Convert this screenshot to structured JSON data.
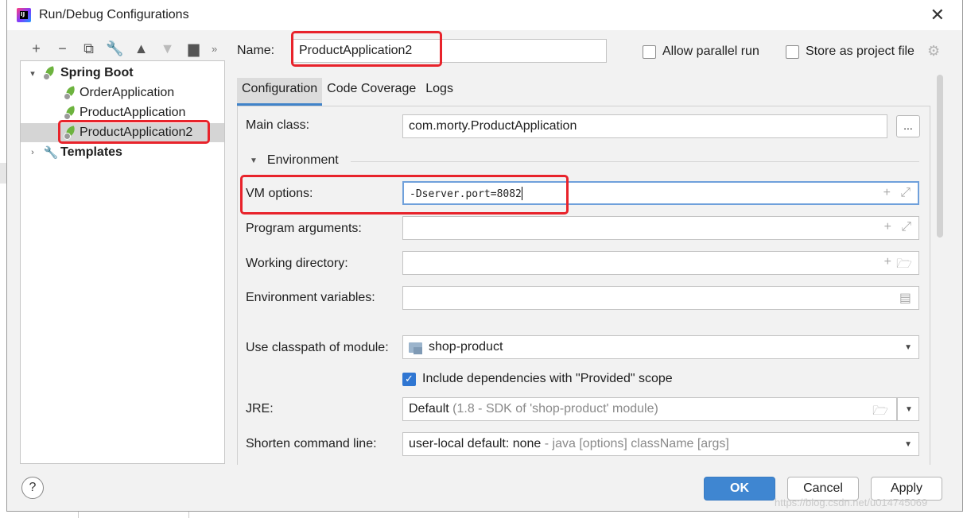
{
  "window": {
    "title": "Run/Debug Configurations",
    "app_icon_text": "IJ"
  },
  "toolbar": {
    "more": "»"
  },
  "tree": {
    "groups": [
      {
        "label": "Spring Boot",
        "expanded": true,
        "items": [
          {
            "label": "OrderApplication"
          },
          {
            "label": "ProductApplication"
          },
          {
            "label": "ProductApplication2",
            "selected": true
          }
        ]
      },
      {
        "label": "Templates",
        "expanded": false
      }
    ]
  },
  "header": {
    "name_label": "Name:",
    "name_value": "ProductApplication2",
    "allow_parallel_label": "Allow parallel run",
    "allow_parallel_checked": false,
    "store_project_label": "Store as project file",
    "store_project_checked": false
  },
  "tabs": [
    {
      "label": "Configuration",
      "active": true
    },
    {
      "label": "Code Coverage",
      "active": false
    },
    {
      "label": "Logs",
      "active": false
    }
  ],
  "form": {
    "main_class_label": "Main class:",
    "main_class_value": "com.morty.ProductApplication",
    "browse_label": "...",
    "environment_section": "Environment",
    "vm_options_label": "VM options:",
    "vm_options_value": "-Dserver.port=8082",
    "program_args_label": "Program arguments:",
    "program_args_value": "",
    "working_dir_label": "Working directory:",
    "working_dir_value": "",
    "env_vars_label": "Environment variables:",
    "env_vars_value": "",
    "classpath_label": "Use classpath of module:",
    "classpath_value": "shop-product",
    "include_deps_label": "Include dependencies with \"Provided\" scope",
    "include_deps_checked": true,
    "jre_label": "JRE:",
    "jre_value": "Default",
    "jre_detail": "(1.8 - SDK of 'shop-product' module)",
    "shorten_label": "Shorten command line:",
    "shorten_value": "user-local default: none",
    "shorten_detail": "- java [options] className [args]"
  },
  "footer": {
    "help_label": "?",
    "ok_label": "OK",
    "cancel_label": "Cancel",
    "apply_label": "Apply",
    "watermark": "https://blog.csdn.net/u014745069"
  },
  "colors": {
    "highlight_red": "#e8232b",
    "accent_blue": "#3f86d1",
    "spring_green": "#6db33f"
  }
}
